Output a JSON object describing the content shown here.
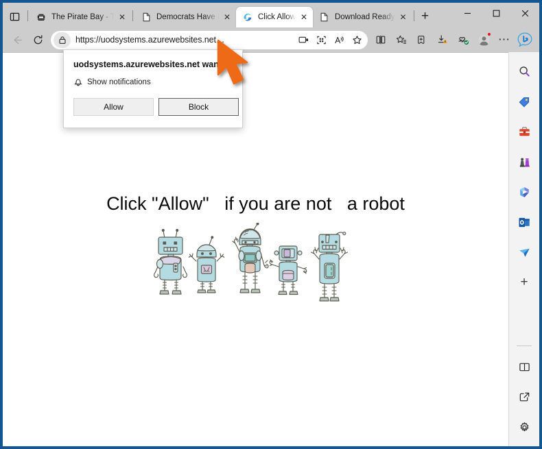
{
  "window": {
    "controls": {
      "minimize": "–",
      "maximize": "☐",
      "close": "✕"
    },
    "border_color": "#14568f",
    "chrome_color": "#cdcdcd"
  },
  "tabstrip": {
    "tab_search_icon": "tab-search-icon",
    "new_tab_label": "+",
    "tabs": [
      {
        "title": "The Pirate Bay - Th",
        "favicon": "pirate-ship-icon",
        "active": false,
        "close_label": "✕"
      },
      {
        "title": "Democrats Have In",
        "favicon": "document-icon",
        "active": false,
        "close_label": "✕"
      },
      {
        "title": "Click Allow",
        "favicon": "edge-logo-icon",
        "active": true,
        "close_label": "✕"
      },
      {
        "title": "Download Ready",
        "favicon": "document-icon",
        "active": false,
        "close_label": "✕"
      }
    ]
  },
  "toolbar": {
    "back_label": "←",
    "refresh_label": "↻",
    "url": "https://uodsystems.azurewebsites.net…",
    "lock_icon": "lock-icon",
    "omnibox_icons": [
      "cast-to-device-icon",
      "qr-code-icon",
      "read-aloud-icon",
      "favorite-star-icon"
    ],
    "action_icons": [
      "split-screen-icon",
      "favorites-icon",
      "collections-icon",
      "downloads-icon",
      "browser-essentials-icon"
    ],
    "profile_icon": "profile-avatar-icon",
    "more_label": "⋯",
    "copilot_icon": "bing-copilot-icon"
  },
  "popup": {
    "title": "uodsystems.azurewebsites.net wants to",
    "permission_icon": "bell-icon",
    "permission_label": "Show notifications",
    "allow_label": "Allow",
    "block_label": "Block"
  },
  "page": {
    "headline": "Click \"Allow\"   if you are not   a robot",
    "illustration": "five-cartoon-robots-illustration",
    "robot_count": 5,
    "robot_body_color": "#b5dbe2",
    "robot_outline_color": "#5d5d52"
  },
  "sidebar": {
    "top_icons": [
      {
        "name": "search-icon"
      },
      {
        "name": "shopping-tag-icon"
      },
      {
        "name": "tools-briefcase-icon"
      },
      {
        "name": "games-chess-icon"
      },
      {
        "name": "microsoft-365-icon"
      },
      {
        "name": "outlook-icon"
      },
      {
        "name": "send-plane-icon"
      }
    ],
    "add_label": "+",
    "bottom_icons": [
      {
        "name": "split-pane-icon"
      },
      {
        "name": "open-external-icon"
      },
      {
        "name": "settings-gear-icon"
      }
    ]
  },
  "cursor": {
    "name": "orange-arrow-cursor",
    "color": "#ef6a17"
  }
}
